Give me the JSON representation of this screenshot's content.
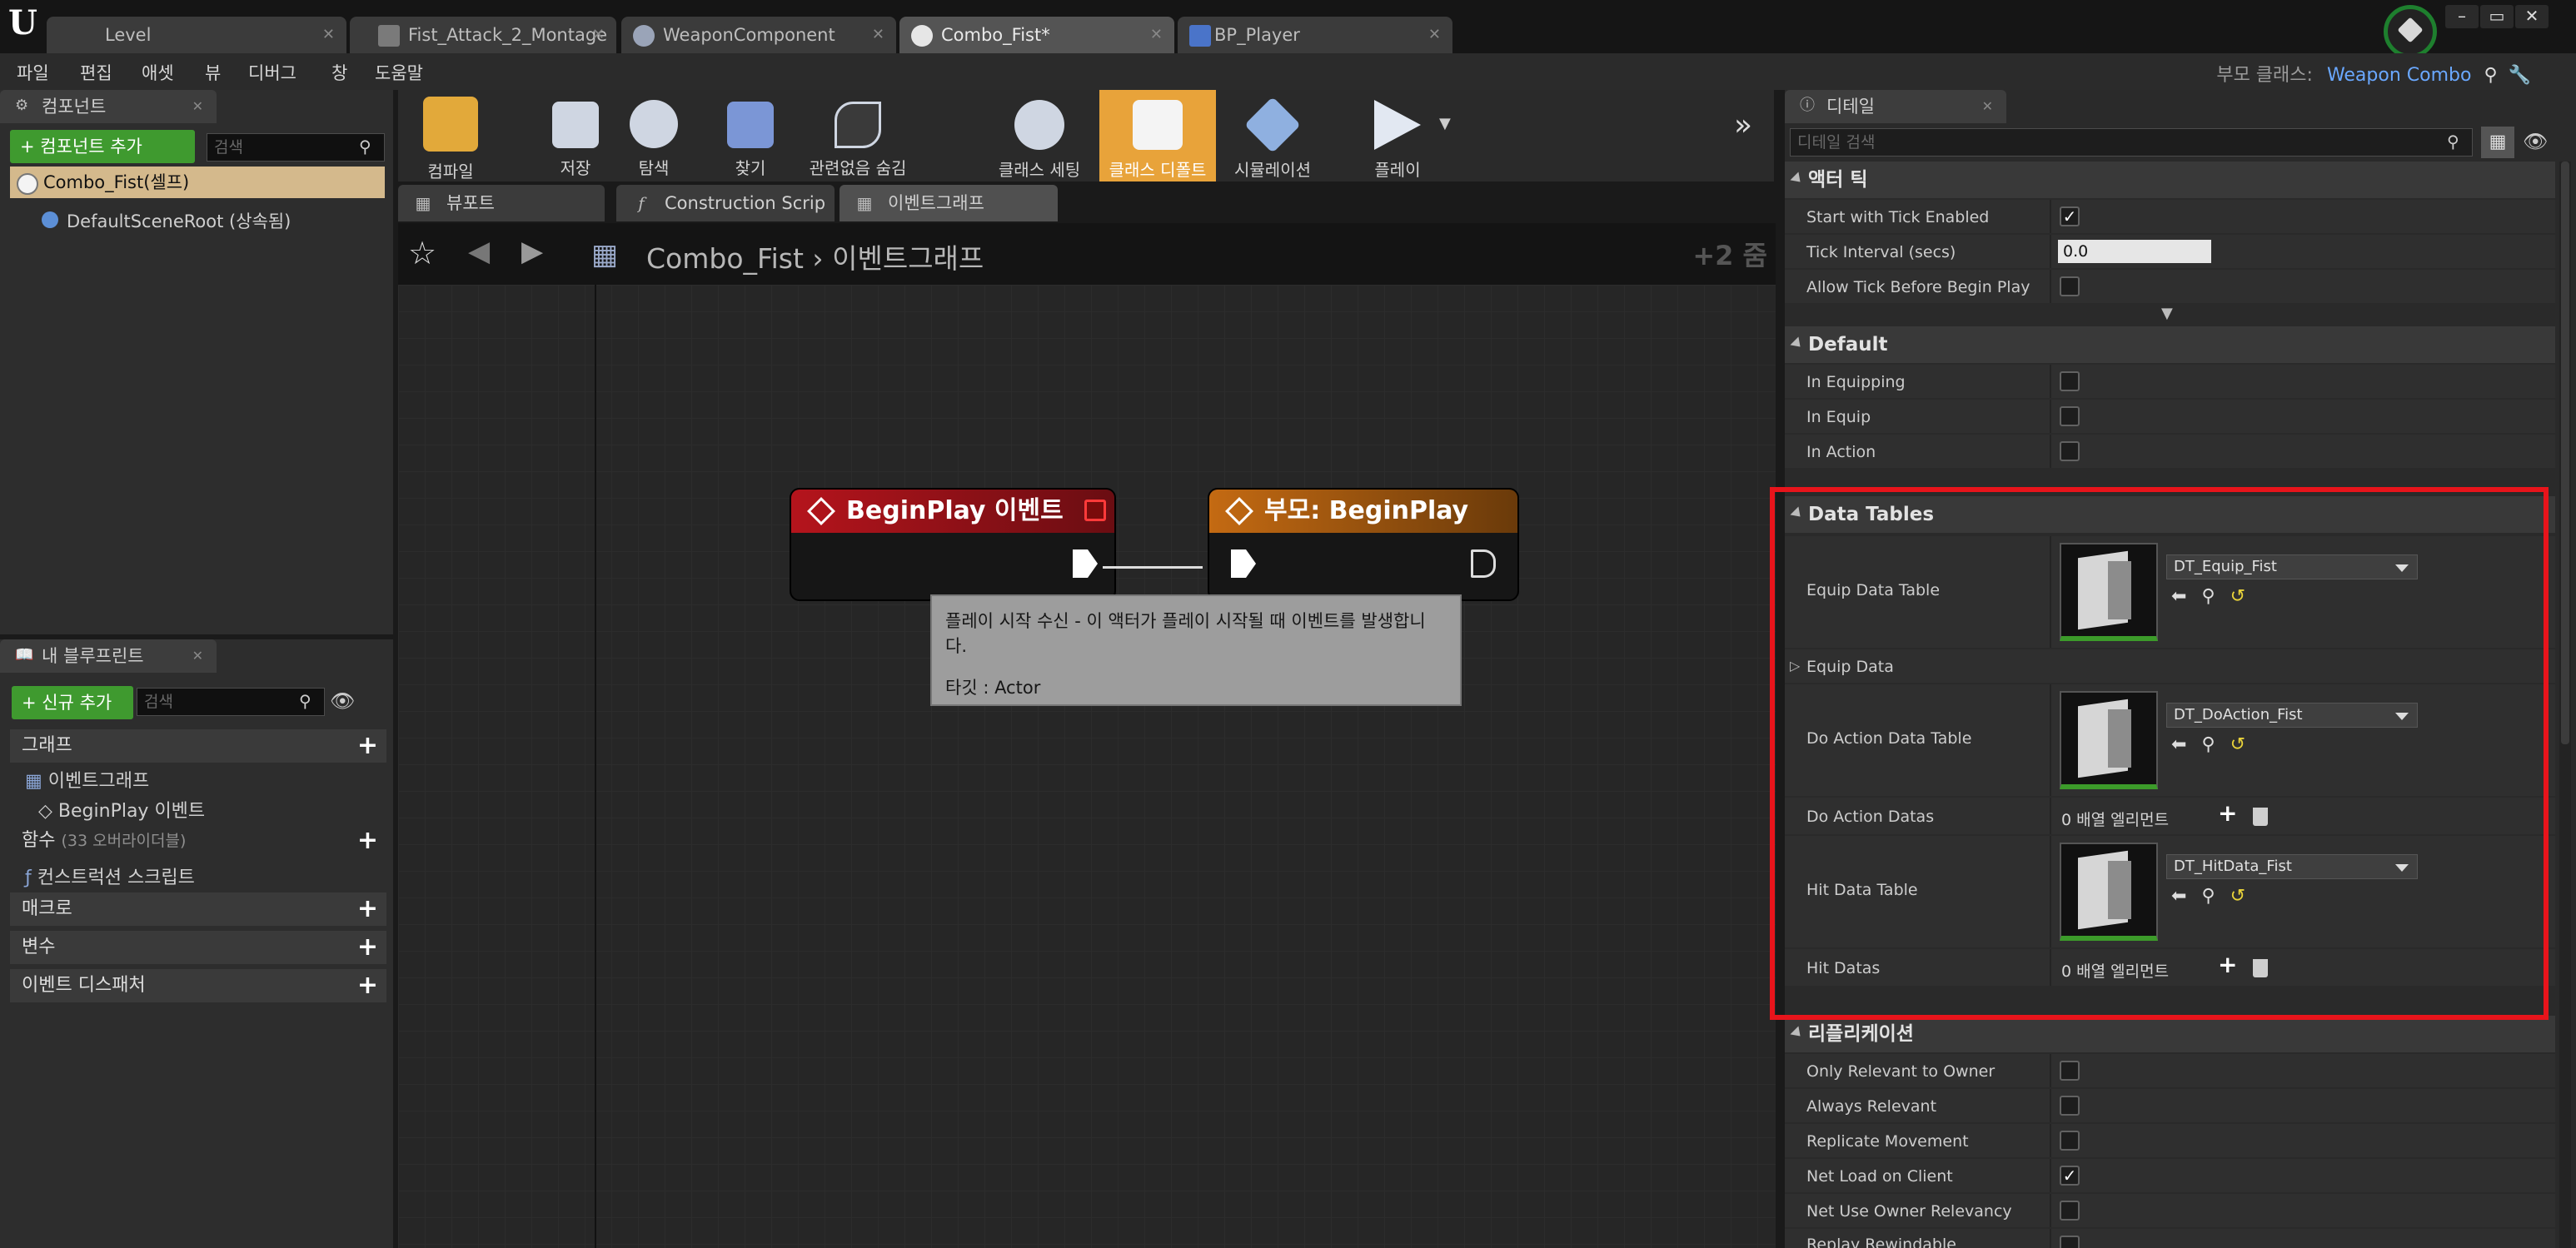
{
  "tabs": [
    {
      "label": "Level"
    },
    {
      "label": "Fist_Attack_2_Montage"
    },
    {
      "label": "WeaponComponent"
    },
    {
      "label": "Combo_Fist*"
    },
    {
      "label": "BP_Player"
    }
  ],
  "window": {
    "minimize": "–",
    "restore": "▭",
    "close": "✕"
  },
  "menu": [
    "파일",
    "편집",
    "애셋",
    "뷰",
    "디버그",
    "창",
    "도움말"
  ],
  "parent_class": {
    "label": "부모 클래스:",
    "value": "Weapon Combo"
  },
  "components": {
    "tab": "컴포넌트",
    "add_button": "+ 컴포넌트 추가",
    "search_placeholder": "검색",
    "root": "Combo_Fist(셀프)",
    "child": "DefaultSceneRoot (상속됨)"
  },
  "my_blueprint": {
    "tab": "내 블루프린트",
    "add_button": "+ 신규 추가",
    "search_placeholder": "검색",
    "sections": {
      "graph": "그래프",
      "event_graph": "이벤트그래프",
      "begin_play": "BeginPlay 이벤트",
      "functions": "함수",
      "functions_note": "(33 오버라이더블)",
      "construction": "컨스트럭션 스크립트",
      "macro": "매크로",
      "variables": "변수",
      "dispatchers": "이벤트 디스패처"
    }
  },
  "toolbar": [
    {
      "label": "컴파일"
    },
    {
      "label": "저장"
    },
    {
      "label": "탐색"
    },
    {
      "label": "찾기"
    },
    {
      "label": "관련없음 숨김"
    },
    {
      "label": "클래스 세팅"
    },
    {
      "label": "클래스 디폴트"
    },
    {
      "label": "시뮬레이션"
    },
    {
      "label": "플레이"
    }
  ],
  "graph_tabs": [
    {
      "label": "뷰포트"
    },
    {
      "label": "Construction Scrip"
    },
    {
      "label": "이벤트그래프"
    }
  ],
  "breadcrumb": {
    "asset": "Combo_Fist",
    "separator": "›",
    "graph": "이벤트그래프",
    "zoom": "+2 줌"
  },
  "nodes": {
    "begin_play": "BeginPlay 이벤트",
    "parent_begin_play": "부모: BeginPlay"
  },
  "tooltip": {
    "line1": "플레이 시작 수신 - 이 액터가 플레이 시작될 때 이벤트를 발생합니다.",
    "line2": "타깃 : Actor"
  },
  "details": {
    "tab": "디테일",
    "search_placeholder": "디테일 검색",
    "actor_tick": {
      "header": "액터 틱",
      "start_with_tick": "Start with Tick Enabled",
      "tick_interval": "Tick Interval (secs)",
      "tick_interval_value": "0.0",
      "allow_tick": "Allow Tick Before Begin Play"
    },
    "default": {
      "header": "Default",
      "in_equipping": "In Equipping",
      "in_equip": "In Equip",
      "in_action": "In Action"
    },
    "data_tables": {
      "header": "Data Tables",
      "equip_table": "Equip Data Table",
      "equip_asset": "DT_Equip_Fist",
      "equip_data": "Equip Data",
      "do_action_table": "Do Action Data Table",
      "do_action_asset": "DT_DoAction_Fist",
      "do_action_datas": "Do Action Datas",
      "do_action_count": "0 배열 엘리먼트",
      "hit_table": "Hit Data Table",
      "hit_asset": "DT_HitData_Fist",
      "hit_datas": "Hit Datas",
      "hit_count": "0 배열 엘리먼트"
    },
    "replication": {
      "header": "리플리케이션",
      "only_relevant": "Only Relevant to Owner",
      "always_relevant": "Always Relevant",
      "replicate_movement": "Replicate Movement",
      "net_load": "Net Load on Client",
      "net_use_owner": "Net Use Owner Relevancy",
      "replay_rewindable": "Replay Rewindable"
    }
  },
  "colors": {
    "accent_orange": "#e8a33a",
    "add_green": "#3f9a2f",
    "event_red": "#b5141c",
    "parent_orange": "#c46a12",
    "highlight_red": "#e8141b",
    "link_blue": "#6aa8ff"
  }
}
